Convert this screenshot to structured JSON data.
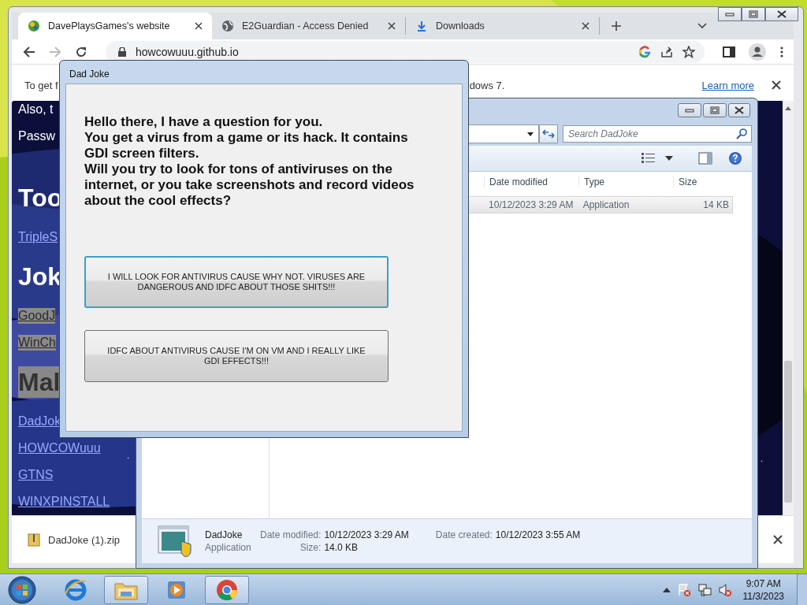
{
  "browser": {
    "tabs": [
      {
        "label": "DavePlaysGames's website",
        "kind": "site",
        "selected": true
      },
      {
        "label": "E2Guardian - Access Denied",
        "kind": "globe",
        "selected": false
      },
      {
        "label": "Downloads",
        "kind": "download",
        "selected": false
      }
    ],
    "url": "howcowuuu.github.io",
    "infobar": {
      "text_start": "To get f",
      "text_end": "dows 7.",
      "link": "Learn more"
    },
    "page": {
      "items": [
        {
          "text": "Also, t",
          "kind": "text"
        },
        {
          "text": "Passw",
          "kind": "text"
        },
        {
          "text": "Too",
          "kind": "heading"
        },
        {
          "text": "TripleS",
          "kind": "link"
        },
        {
          "text": "Jok",
          "kind": "heading"
        },
        {
          "text": "GoodJ",
          "kind": "tag"
        },
        {
          "text": "WinCh",
          "kind": "tag"
        },
        {
          "text": "Mal",
          "kind": "tag-heading"
        },
        {
          "text": "DadJok",
          "kind": "link"
        },
        {
          "text": "HOWCOWuuu",
          "kind": "link"
        },
        {
          "text": "GTNS",
          "kind": "link"
        },
        {
          "text": "WINXPINSTALL",
          "kind": "link"
        }
      ]
    },
    "download": {
      "file": "DadJoke (1).zip"
    }
  },
  "explorer": {
    "search_placeholder": "Search DadJoke",
    "columns": [
      "Date modified",
      "Type",
      "Size"
    ],
    "rows": [
      {
        "cells": [
          "10/12/2023 3:29 AM",
          "Application",
          "14 KB"
        ],
        "selected": true
      }
    ],
    "details": {
      "name": "DadJoke",
      "type": "Application",
      "fields": [
        {
          "label": "Date modified:",
          "value": "10/12/2023 3:29 AM"
        },
        {
          "label": "Size:",
          "value": "14.0 KB"
        },
        {
          "label": "Date created:",
          "value": "10/12/2023 3:55 AM"
        }
      ]
    }
  },
  "dialog": {
    "title": "Dad Joke",
    "message": [
      "Hello there, I have a question for you.",
      "You get a virus from a game or its hack. It contains GDI screen filters.",
      "Will you try to look for tons of antiviruses on the internet, or you take screenshots and record videos about the cool effects?"
    ],
    "buttons": [
      {
        "label": "I WILL LOOK FOR ANTIVIRUS CAUSE WHY NOT. VIRUSES ARE DANGEROUS AND IDFC ABOUT THOSE SHITS!!!",
        "focused": true
      },
      {
        "label": "IDFC ABOUT ANTIVIRUS CAUSE I'M ON VM AND I REALLY LIKE GDI EFFECTS!!!",
        "focused": false
      }
    ]
  },
  "taskbar": {
    "apps": [
      {
        "kind": "ie",
        "running": false
      },
      {
        "kind": "explorer",
        "running": true
      },
      {
        "kind": "media",
        "running": false
      },
      {
        "kind": "chrome",
        "running": true
      }
    ],
    "time": "9:07 AM",
    "date": "11/3/2023"
  }
}
